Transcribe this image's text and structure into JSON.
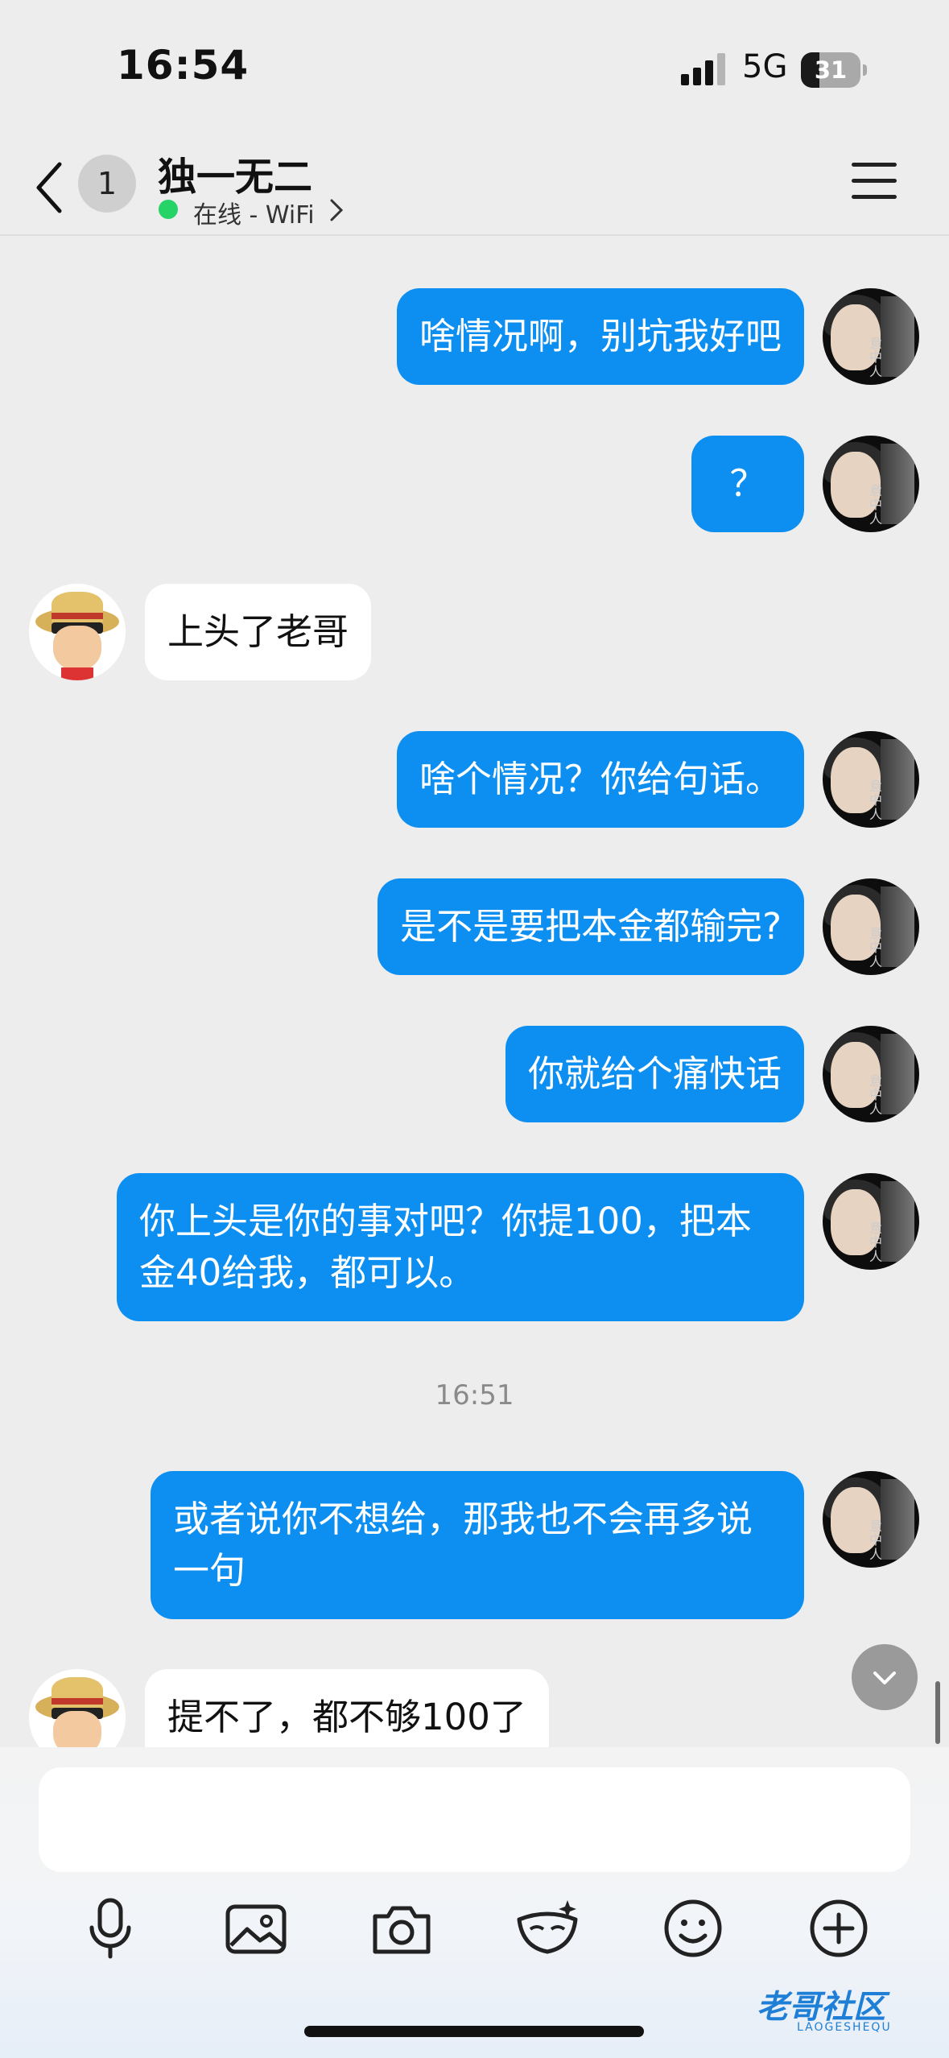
{
  "status_bar": {
    "time": "16:54",
    "network": "5G",
    "battery": "31",
    "battery_fraction": 0.31
  },
  "header": {
    "unread_count": "1",
    "title": "独一无二",
    "status": "在线 - WiFi"
  },
  "messages": [
    {
      "type": "me",
      "text": "啥情况啊，别坑我好吧"
    },
    {
      "type": "me",
      "text": "？"
    },
    {
      "type": "other",
      "text": "上头了老哥"
    },
    {
      "type": "me",
      "text": "啥个情况？你给句话。"
    },
    {
      "type": "me",
      "text": "是不是要把本金都输完?"
    },
    {
      "type": "me",
      "text": "你就给个痛快话"
    },
    {
      "type": "me",
      "text": "你上头是你的事对吧？你提100，把本金40给我，都可以。"
    },
    {
      "type": "time",
      "text": "16:51"
    },
    {
      "type": "me",
      "text": "或者说你不想给，那我也不会再多说一句"
    },
    {
      "type": "other",
      "text": "提不了，都不够100了"
    }
  ],
  "avatar_me_text": "意中人",
  "composer": {
    "input_value": "",
    "tools": [
      "microphone-icon",
      "image-icon",
      "camera-icon",
      "sticker-icon",
      "emoji-icon",
      "plus-icon"
    ]
  },
  "watermark": {
    "text": "老哥社区",
    "sub": "LAOGESHEQU"
  },
  "colors": {
    "accent": "#0d8ff2",
    "background": "#ededed",
    "online": "#25d366"
  }
}
